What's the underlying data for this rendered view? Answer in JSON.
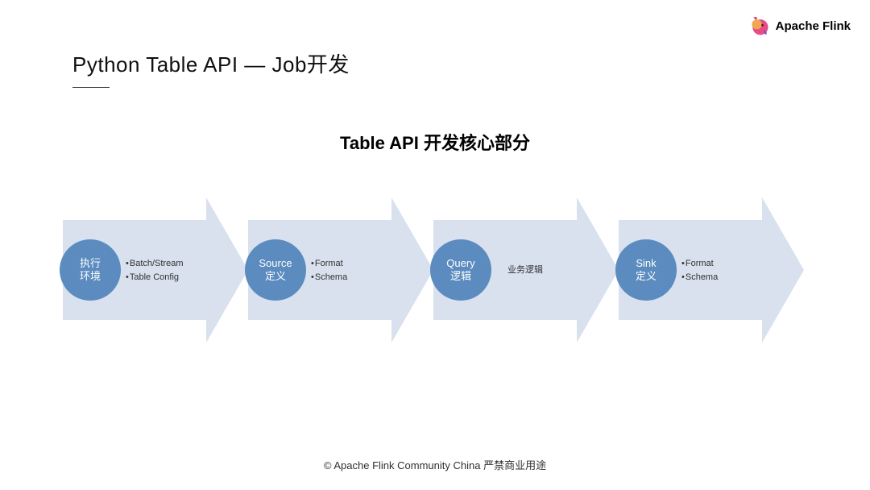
{
  "brand": {
    "name": "Apache Flink"
  },
  "title": "Python Table API — Job开发",
  "subtitle": "Table API 开发核心部分",
  "steps": [
    {
      "label_line1": "执行",
      "label_line2": "环境",
      "bullets": [
        "Batch/Stream",
        "Table Config"
      ]
    },
    {
      "label_line1": "Source",
      "label_line2": "定义",
      "bullets": [
        "Format",
        "Schema"
      ]
    },
    {
      "label_line1": "Query",
      "label_line2": "逻辑",
      "bullets": [
        "业务逻辑"
      ]
    },
    {
      "label_line1": "Sink",
      "label_line2": "定义",
      "bullets": [
        "Format",
        "Schema"
      ]
    }
  ],
  "footer": "© Apache Flink Community China  严禁商业用途",
  "colors": {
    "arrow": "#d8e1ed",
    "node": "#5b8bbf"
  }
}
